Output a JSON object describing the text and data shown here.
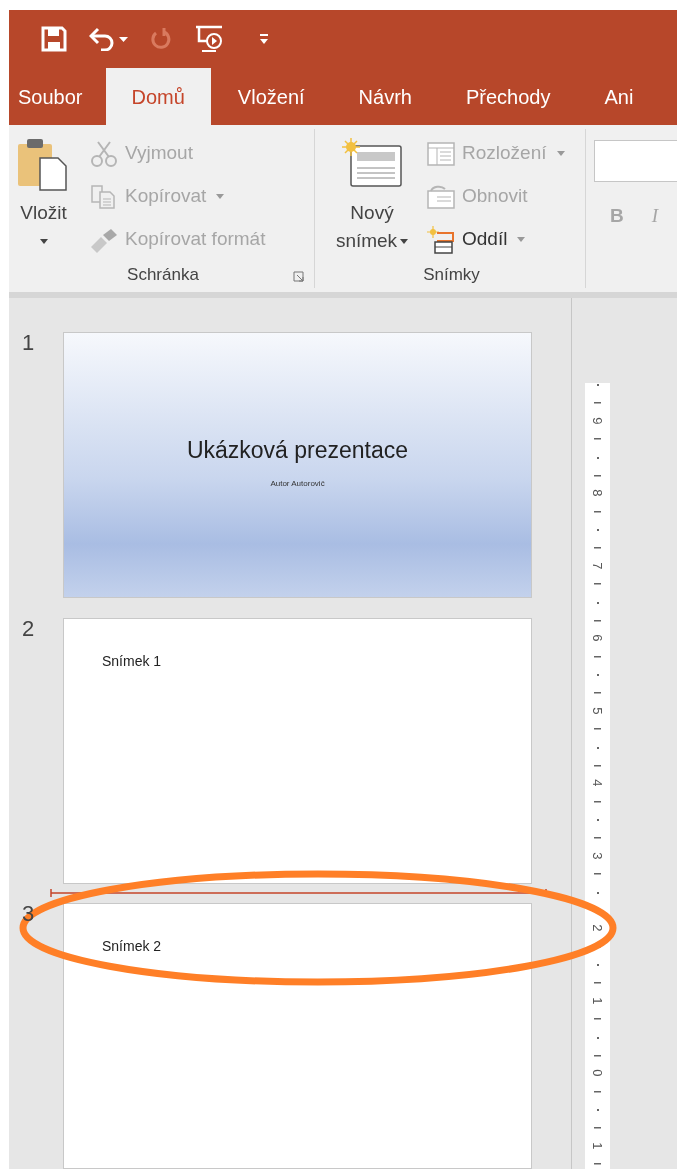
{
  "quick_access": [
    {
      "kind": "save",
      "disabled": false
    },
    {
      "kind": "undo",
      "disabled": false,
      "dropdown": true
    },
    {
      "kind": "redo",
      "disabled": true
    },
    {
      "kind": "slideshow",
      "disabled": false
    },
    {
      "kind": "customize",
      "disabled": false
    }
  ],
  "tabs": [
    {
      "label": "Soubor",
      "selected": false
    },
    {
      "label": "Domů",
      "selected": true
    },
    {
      "label": "Vložení",
      "selected": false
    },
    {
      "label": "Návrh",
      "selected": false
    },
    {
      "label": "Přechody",
      "selected": false
    },
    {
      "label": "Ani",
      "selected": false
    }
  ],
  "ribbon": {
    "groups": [
      {
        "label": "Schránka",
        "launcher": true,
        "large": {
          "kind": "paste",
          "label": "Vložit",
          "dropdown": true
        },
        "small": [
          {
            "kind": "cut",
            "label": "Vyjmout",
            "disabled": true
          },
          {
            "kind": "copy",
            "label": "Kopírovat",
            "disabled": true,
            "dropdown": true
          },
          {
            "kind": "painter",
            "label": "Kopírovat formát",
            "disabled": true
          }
        ]
      },
      {
        "label": "Snímky",
        "large": {
          "kind": "newslide",
          "label": "Nový",
          "label_2": "snímek",
          "dropdown": true
        },
        "small": [
          {
            "kind": "layout",
            "label": "Rozložení",
            "disabled": true,
            "dropdown": true
          },
          {
            "kind": "reset",
            "label": "Obnovit",
            "disabled": true
          },
          {
            "kind": "section",
            "label": "Oddíl",
            "disabled": false,
            "dropdown": true
          }
        ]
      }
    ],
    "font": {
      "bold": "B",
      "italic": "I",
      "disabled": true
    }
  },
  "slides": [
    {
      "number": "1",
      "kind": "title",
      "title": "Ukázková prezentace",
      "subtitle": "Autor Autorovič"
    },
    {
      "number": "2",
      "kind": "content",
      "title": "Snímek 1"
    },
    {
      "number": "3",
      "kind": "content",
      "title": "Snímek 2"
    }
  ],
  "ruler": {
    "labels": [
      "9",
      "8",
      "7",
      "6",
      "5",
      "4",
      "3",
      "2",
      "1",
      "0",
      "1"
    ]
  }
}
